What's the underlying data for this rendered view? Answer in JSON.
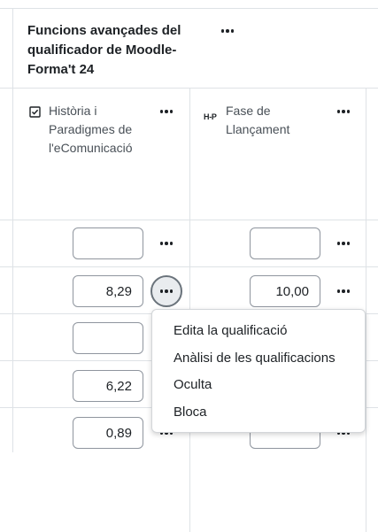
{
  "category": {
    "title": "Funcions avançades del qualificador de Moodle-Forma't 24"
  },
  "columns": [
    {
      "label": "Història i Paradigmes de l'eComunicació",
      "icon": "checkbox-icon"
    },
    {
      "label": "Fase de Llançament",
      "icon": "h5p-icon",
      "icon_text": "H-P"
    }
  ],
  "rows": [
    {
      "col1": "",
      "col2": ""
    },
    {
      "col1": "8,29",
      "col2": "10,00"
    },
    {
      "col1": "",
      "col2": ""
    },
    {
      "col1": "6,22",
      "col2": ""
    },
    {
      "col1": "0,89",
      "col2": ""
    }
  ],
  "menu": {
    "items": [
      "Edita la qualificació",
      "Anàlisi de les qualificacions",
      "Oculta",
      "Bloca"
    ]
  }
}
